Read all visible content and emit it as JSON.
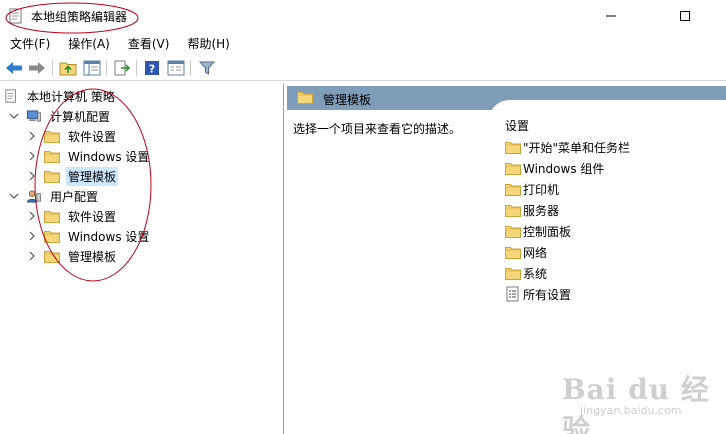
{
  "window": {
    "title": "本地组策略编辑器"
  },
  "menu": [
    "文件(F)",
    "操作(A)",
    "查看(V)",
    "帮助(H)"
  ],
  "toolbar": {
    "icons": [
      "back-arrow-icon",
      "forward-arrow-icon",
      "up-folder-icon",
      "show-hide-tree-icon",
      "export-list-icon",
      "help-icon",
      "properties-icon",
      "filter-icon"
    ]
  },
  "tree": {
    "root": "本地计算机 策略",
    "computer": {
      "label": "计算机配置",
      "children": [
        "软件设置",
        "Windows 设置",
        "管理模板"
      ]
    },
    "user": {
      "label": "用户配置",
      "children": [
        "软件设置",
        "Windows 设置",
        "管理模板"
      ]
    }
  },
  "right": {
    "header": "管理模板",
    "description": "选择一个项目来查看它的描述。",
    "settings_title": "设置",
    "items": [
      "\"开始\"菜单和任务栏",
      "Windows 组件",
      "打印机",
      "服务器",
      "控制面板",
      "网络",
      "系统",
      "所有设置"
    ]
  },
  "watermark": {
    "brand": "Bai du 经验",
    "url": "jingyan.baidu.com"
  },
  "colors": {
    "header_bar": "#7f9db9",
    "selection": "#cce8ff",
    "folder": "#f5d77a",
    "annotation": "#c0001a"
  }
}
